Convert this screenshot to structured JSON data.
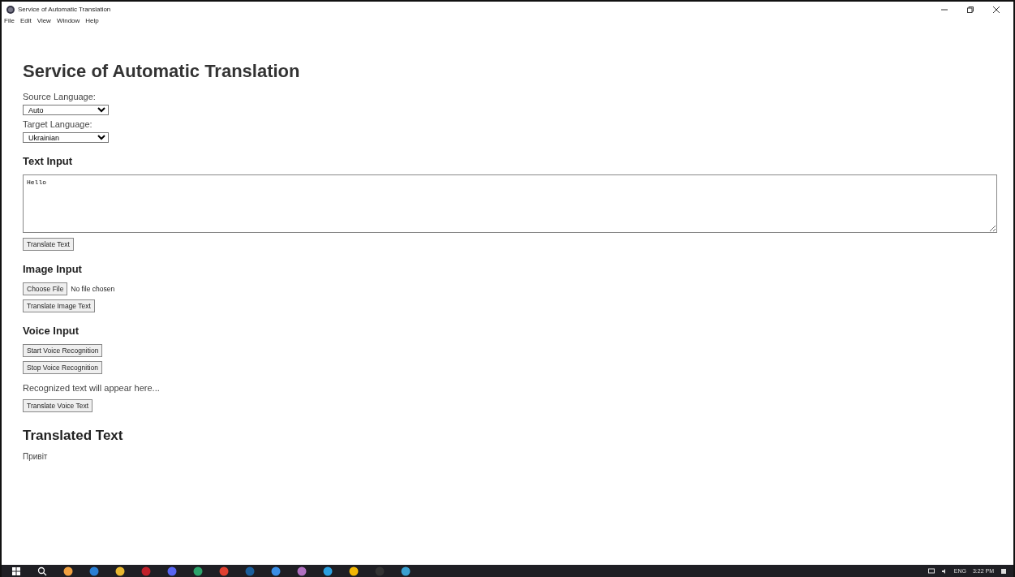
{
  "window": {
    "title": "Service of Automatic Translation"
  },
  "menu": [
    "File",
    "Edit",
    "View",
    "Window",
    "Help"
  ],
  "heading": "Service of Automatic Translation",
  "source_language": {
    "label": "Source Language:",
    "value": "Auto"
  },
  "target_language": {
    "label": "Target Language:",
    "value": "Ukrainian"
  },
  "text_input": {
    "heading": "Text Input",
    "value": "Hello",
    "button": "Translate Text"
  },
  "image_input": {
    "heading": "Image Input",
    "file_button": "Choose File",
    "file_status": "No file chosen",
    "button": "Translate Image Text"
  },
  "voice_input": {
    "heading": "Voice Input",
    "buttons": [
      "Start Voice Recognition",
      "Stop Voice Recognition"
    ],
    "recognized_text": "Recognized text will appear here...",
    "button": "Translate Voice Text"
  },
  "translated": {
    "heading": "Translated Text",
    "text": "Привіт"
  },
  "taskbar": {
    "language": "ENG",
    "time": "3:22 PM"
  }
}
